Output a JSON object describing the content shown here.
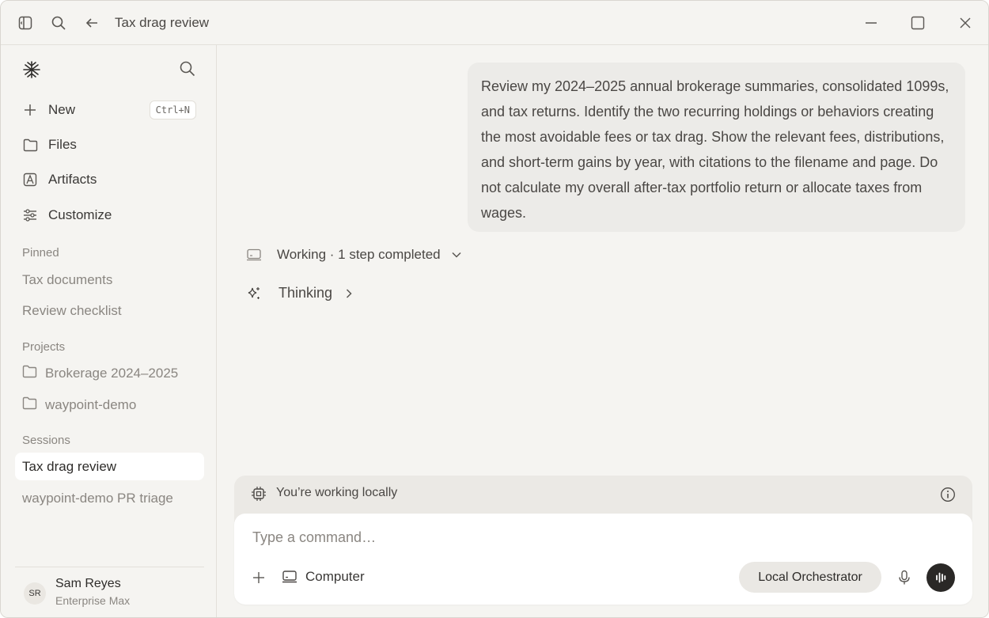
{
  "titlebar": {
    "title": "Tax drag review"
  },
  "sidebar": {
    "new_label": "New",
    "new_shortcut": "Ctrl+N",
    "files_label": "Files",
    "artifacts_label": "Artifacts",
    "customize_label": "Customize",
    "pinned_heading": "Pinned",
    "pinned": [
      "Tax documents",
      "Review checklist"
    ],
    "projects_heading": "Projects",
    "projects": [
      "Brokerage 2024–2025",
      "waypoint-demo"
    ],
    "sessions_heading": "Sessions",
    "sessions": [
      "Tax drag review",
      "waypoint-demo PR triage"
    ],
    "user": {
      "initials": "SR",
      "name": "Sam Reyes",
      "plan": "Enterprise Max"
    }
  },
  "chat": {
    "user_message": "Review my 2024–2025 annual brokerage summaries, consolidated 1099s, and tax returns. Identify the two recurring holdings or behaviors creating the most avoidable fees or tax drag. Show the relevant fees, distributions, and short-term gains by year, with citations to the filename and page. Do not calculate my overall after-tax portfolio return or allocate taxes from wages.",
    "working_status": "Working · 1 step completed",
    "thinking_label": "Thinking"
  },
  "composer": {
    "local_notice": "You’re working locally",
    "placeholder": "Type a command…",
    "value": "",
    "computer_label": "Computer",
    "orchestrator_label": "Local Orchestrator"
  }
}
